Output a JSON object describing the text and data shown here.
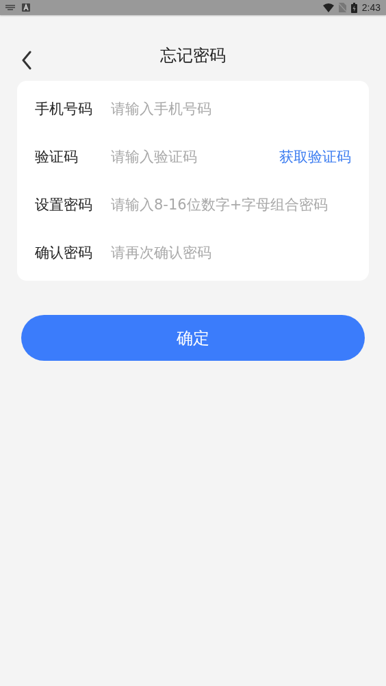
{
  "status_bar": {
    "time": "2:43"
  },
  "header": {
    "title": "忘记密码"
  },
  "form": {
    "fields": [
      {
        "label": "手机号码",
        "placeholder": "请输入手机号码"
      },
      {
        "label": "验证码",
        "placeholder": "请输入验证码",
        "action": "获取验证码"
      },
      {
        "label": "设置密码",
        "placeholder": "请输入8-16位数字+字母组合密码"
      },
      {
        "label": "确认密码",
        "placeholder": "请再次确认密码"
      }
    ]
  },
  "submit_button": "确定"
}
